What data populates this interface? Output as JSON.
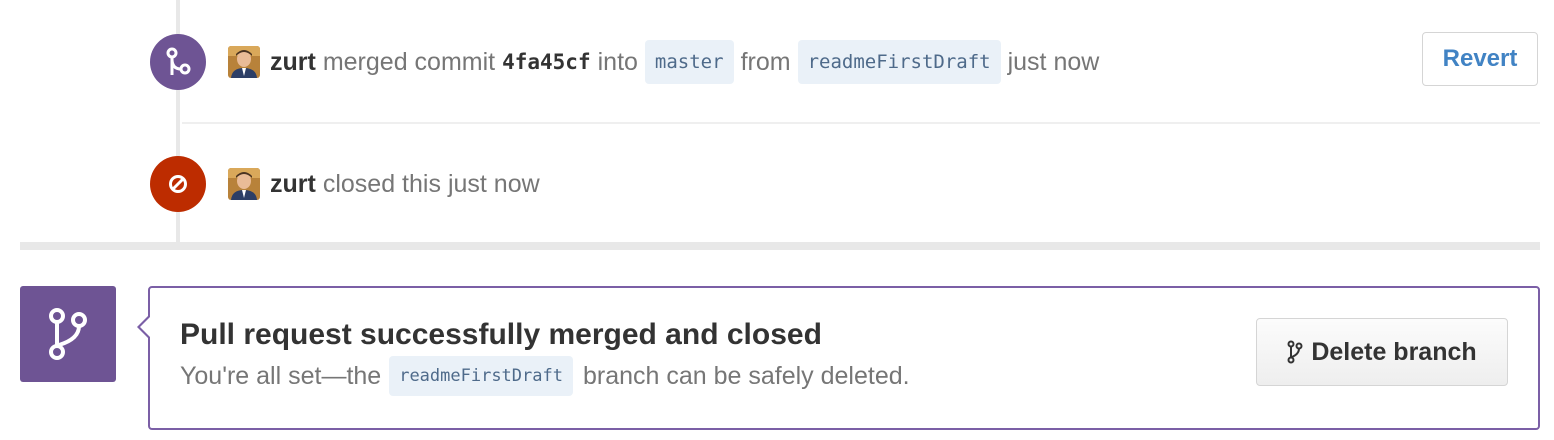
{
  "timeline": {
    "events": [
      {
        "type": "merged",
        "icon": "git-merge-icon",
        "badge_color": "#6e5494",
        "author": "zurt",
        "action": "merged commit",
        "commit_sha": "4fa45cf",
        "into_word": "into",
        "target_branch": "master",
        "from_word": "from",
        "source_branch": "readmeFirstDraft",
        "time": "just now",
        "revert_label": "Revert"
      },
      {
        "type": "closed",
        "icon": "circle-slash-icon",
        "badge_color": "#bd2c00",
        "author": "zurt",
        "action": "closed this",
        "time": "just now"
      }
    ]
  },
  "merge_status": {
    "icon": "git-branch-icon",
    "accent_color": "#6e5494",
    "title": "Pull request successfully merged and closed",
    "desc_prefix": "You're all set—the",
    "branch": "readmeFirstDraft",
    "desc_suffix": "branch can be safely deleted.",
    "delete_button_label": "Delete branch"
  },
  "colors": {
    "link": "#4183c4",
    "branch_tag_bg": "#eaf1f8",
    "branch_tag_text": "#4e6a8a"
  }
}
